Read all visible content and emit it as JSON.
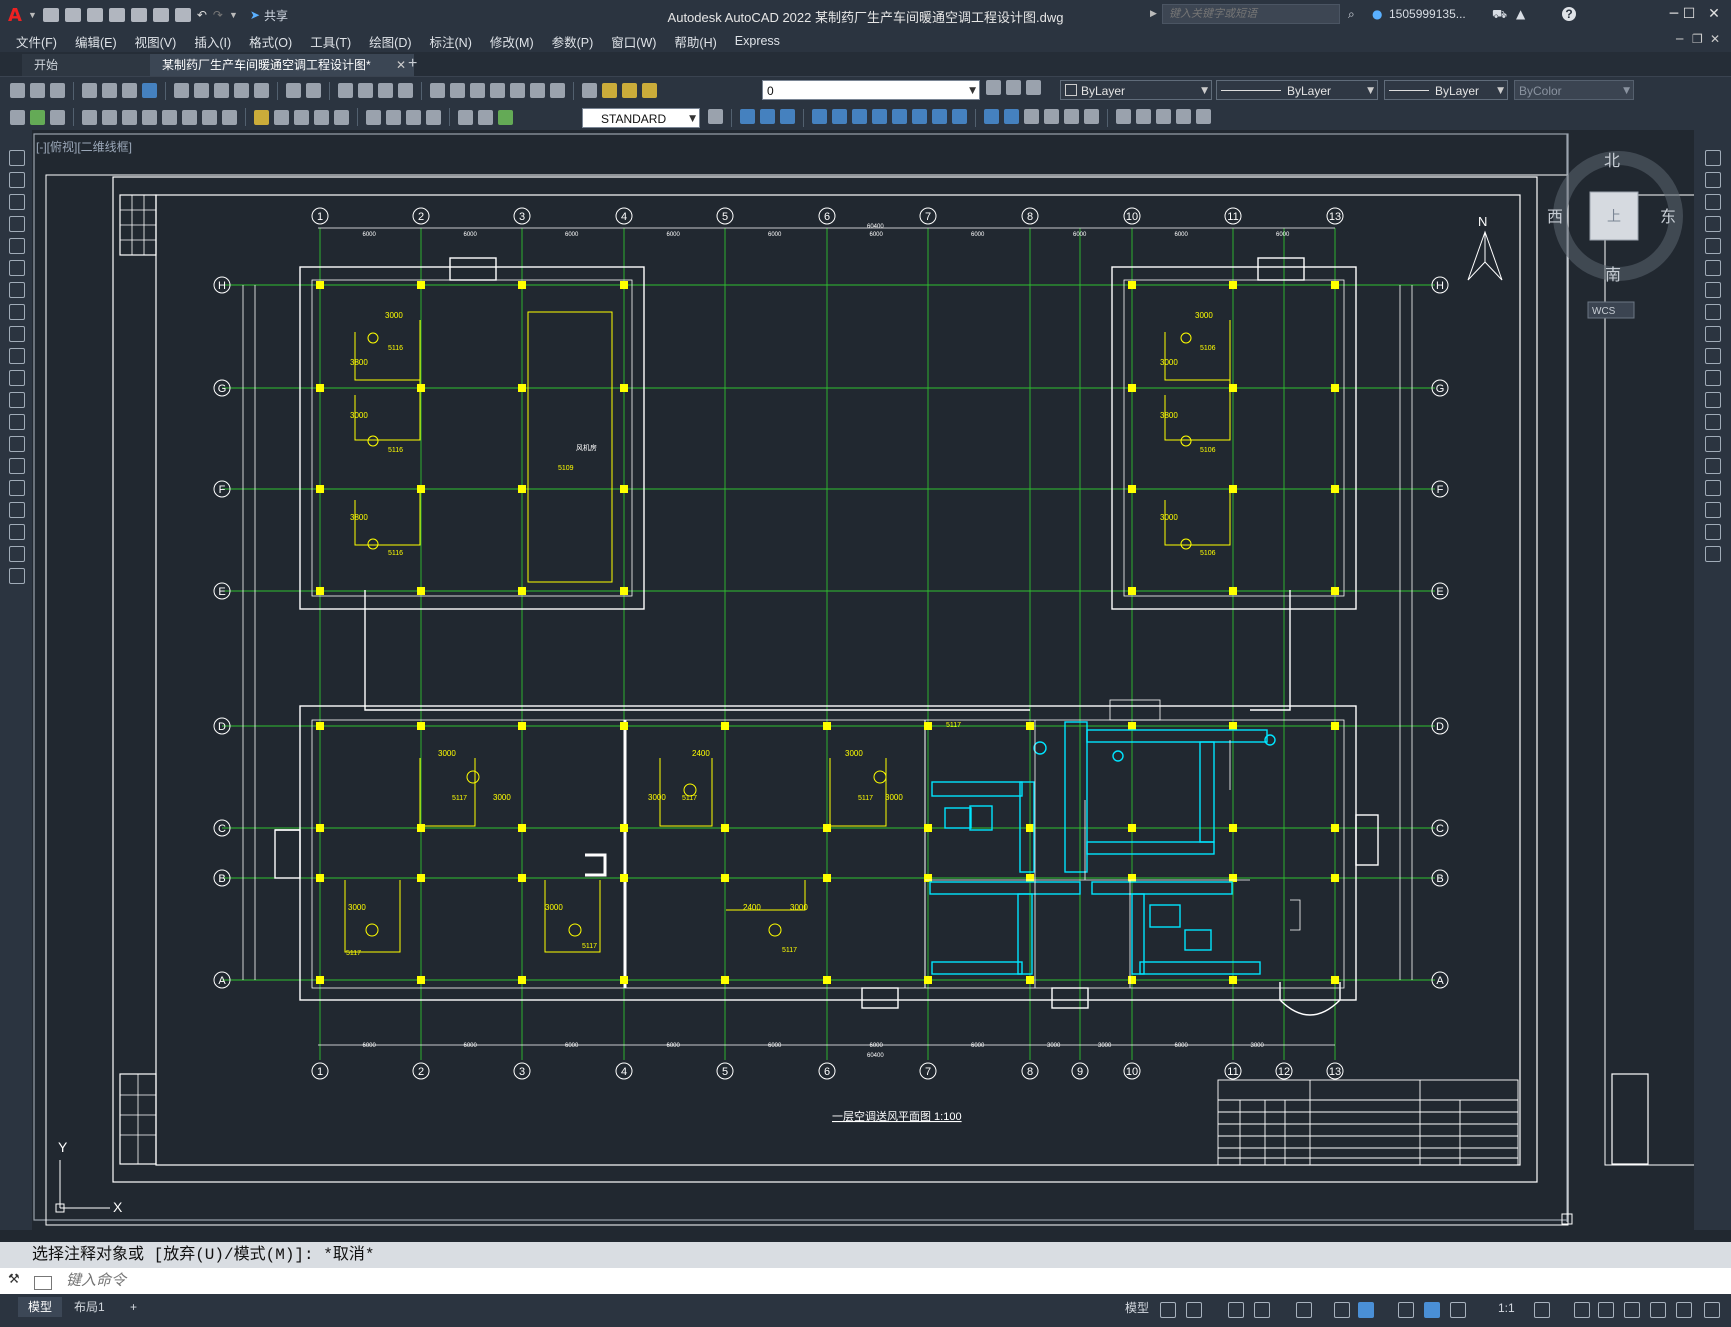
{
  "app": {
    "title": "Autodesk AutoCAD 2022    某制药厂生产车间暖通空调工程设计图.dwg",
    "share_label": "共享",
    "search_placeholder": "键入关键字或短语",
    "user_id": "1505999135...",
    "help_icon": "?"
  },
  "menus": [
    "文件(F)",
    "编辑(E)",
    "视图(V)",
    "插入(I)",
    "格式(O)",
    "工具(T)",
    "绘图(D)",
    "标注(N)",
    "修改(M)",
    "参数(P)",
    "窗口(W)",
    "帮助(H)",
    "Express"
  ],
  "tabs": {
    "start": "开始",
    "active": "某制药厂生产车间暖通空调工程设计图*",
    "close": "✕",
    "add": "+"
  },
  "toolbar": {
    "layer_value": "0",
    "color_value": "ByLayer",
    "linetype_value": "ByLayer",
    "lineweight_value": "ByLayer",
    "plotstyle_value": "ByColor",
    "textstyle_value": "STANDARD"
  },
  "viewport": {
    "label": "[-][俯视][二维线框]",
    "viewcube": {
      "north": "北",
      "south": "南",
      "east": "东",
      "west": "西",
      "face": "上",
      "wcs": "WCS"
    },
    "compass_n": "N",
    "ucs_x": "X",
    "ucs_y": "Y"
  },
  "drawing": {
    "plan_title": "一层空调送风平面图 1:100",
    "axis_top": [
      "1",
      "2",
      "3",
      "4",
      "5",
      "6",
      "7",
      "8",
      "10",
      "11",
      "13"
    ],
    "axis_bottom": [
      "1",
      "2",
      "3",
      "4",
      "5",
      "6",
      "7",
      "8",
      "9",
      "10",
      "11",
      "12",
      "13"
    ],
    "axis_rows": [
      "H",
      "G",
      "F",
      "E",
      "D",
      "C",
      "B",
      "A"
    ],
    "dim_top": [
      "6000",
      "6000",
      "6000",
      "6000",
      "6000",
      "6000",
      "6000",
      "6000",
      "6000",
      "6000"
    ],
    "dim_top_total": "60400",
    "dim_bottom": [
      "6000",
      "6000",
      "6000",
      "6000",
      "6000",
      "6000",
      "6000",
      "3000",
      "3000",
      "6000",
      "3000"
    ],
    "dim_bottom_total": "60400",
    "duct_dims": [
      "3000",
      "3000",
      "3800",
      "3000",
      "3800",
      "3000",
      "3800",
      "3000",
      "3000",
      "2400",
      "3000",
      "3000",
      "3000",
      "3000",
      "3000",
      "3000",
      "2400",
      "3000"
    ],
    "diffuser_tags": [
      "5116",
      "5116",
      "5116",
      "5106",
      "5106",
      "5106",
      "5109",
      "5117",
      "5117",
      "5117",
      "5117",
      "5117",
      "5117",
      "5117"
    ],
    "room_text": "风机房"
  },
  "command": {
    "history": "选择注释对象或 [放弃(U)/模式(M)]: *取消*",
    "placeholder": "键入命令"
  },
  "status": {
    "tabs": [
      "模型",
      "布局1"
    ],
    "add": "+",
    "model_label": "模型",
    "scale": "1:1"
  }
}
